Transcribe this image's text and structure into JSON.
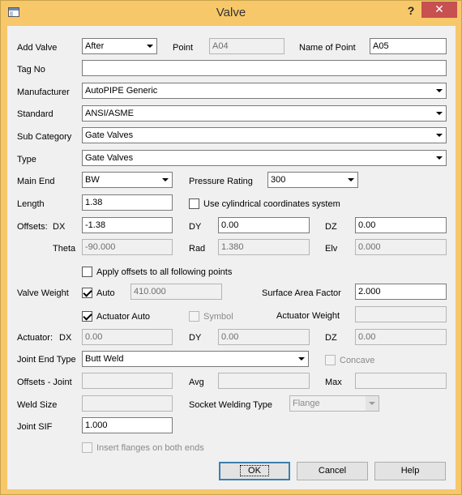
{
  "window": {
    "title": "Valve",
    "help_glyph": "?",
    "close_glyph": "✕"
  },
  "row_add_valve": {
    "label": "Add Valve",
    "value": "After",
    "point_label": "Point",
    "point_value": "A04",
    "name_label": "Name of Point",
    "name_value": "A05"
  },
  "tag": {
    "label": "Tag No",
    "value": ""
  },
  "manufacturer": {
    "label": "Manufacturer",
    "value": "AutoPIPE Generic"
  },
  "standard": {
    "label": "Standard",
    "value": "ANSI/ASME"
  },
  "sub_category": {
    "label": "Sub Category",
    "value": "Gate Valves"
  },
  "type": {
    "label": "Type",
    "value": "Gate Valves"
  },
  "main_end": {
    "label": "Main End",
    "value": "BW",
    "pressure_label": "Pressure Rating",
    "pressure_value": "300"
  },
  "length": {
    "label": "Length",
    "value": "1.38",
    "cyl_label": "Use cylindrical coordinates system"
  },
  "offsets": {
    "label": "Offsets:",
    "dx_label": "DX",
    "dx": "-1.38",
    "dy_label": "DY",
    "dy": "0.00",
    "dz_label": "DZ",
    "dz": "0.00",
    "theta_label": "Theta",
    "theta": "-90.000",
    "rad_label": "Rad",
    "rad": "1.380",
    "elv_label": "Elv",
    "elv": "0.000"
  },
  "apply_offsets": {
    "label": "Apply offsets to all following points"
  },
  "valve_weight": {
    "label": "Valve Weight",
    "auto_label": "Auto",
    "auto_value": "410.000",
    "saf_label": "Surface Area Factor",
    "saf_value": "2.000"
  },
  "actuator": {
    "auto_label": "Actuator Auto",
    "symbol_label": "Symbol",
    "weight_label": "Actuator Weight",
    "weight_value": "",
    "label": "Actuator:",
    "dx_label": "DX",
    "dx": "0.00",
    "dy_label": "DY",
    "dy": "0.00",
    "dz_label": "DZ",
    "dz": "0.00"
  },
  "joint": {
    "end_type_label": "Joint End Type",
    "end_type_value": "Butt Weld",
    "concave_label": "Concave",
    "offsets_label": "Offsets - Joint",
    "offsets_value": "",
    "avg_label": "Avg",
    "avg_value": "",
    "max_label": "Max",
    "max_value": "",
    "weld_size_label": "Weld Size",
    "weld_size_value": "",
    "socket_label": "Socket Welding Type",
    "socket_value": "Flange",
    "sif_label": "Joint SIF",
    "sif_value": "1.000"
  },
  "insert_flanges": {
    "label": "Insert flanges on both ends"
  },
  "buttons": {
    "ok": "OK",
    "cancel": "Cancel",
    "help": "Help"
  }
}
